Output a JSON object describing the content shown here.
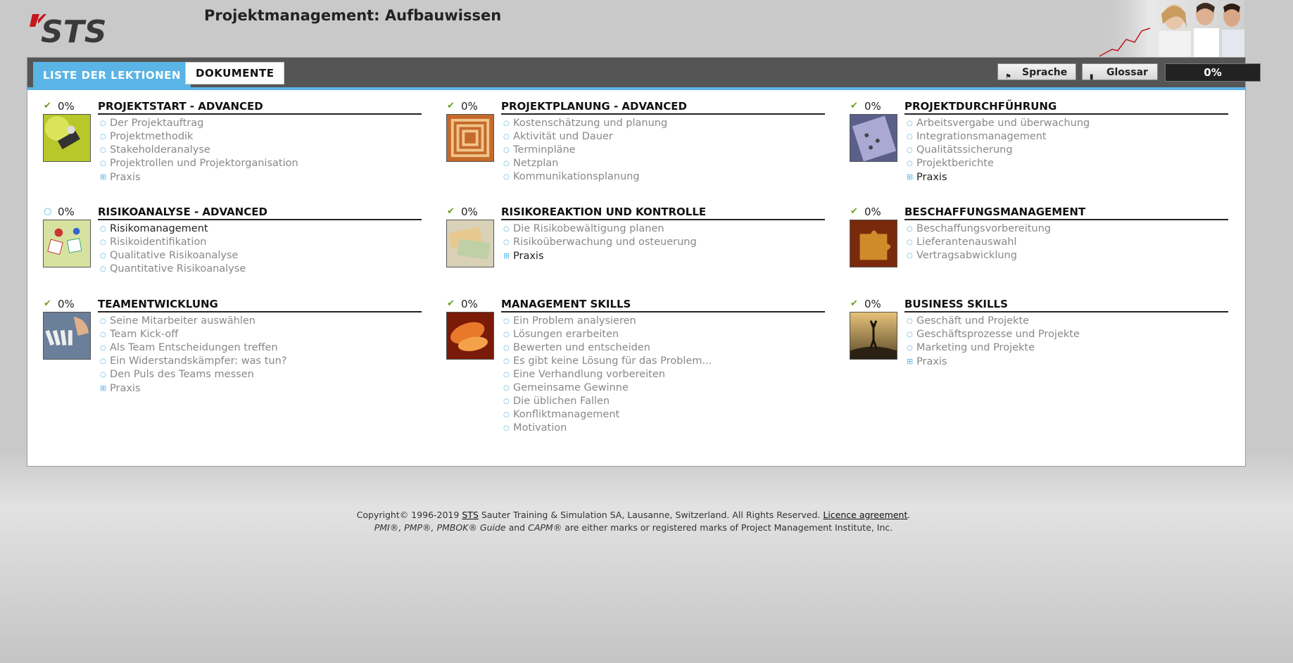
{
  "header": {
    "title": "Projektmanagement: Aufbauwissen"
  },
  "tabs": {
    "active": "LISTE DER LEKTIONEN",
    "inactive": "DOKUMENTE"
  },
  "toolbar": {
    "language_label": "Sprache",
    "glossary_label": "Glossar",
    "overall_progress": "0%"
  },
  "modules": [
    {
      "title": "PROJEKTSTART - ADVANCED",
      "progress": "0%",
      "status": "check",
      "lessons": [
        "Der Projektauftrag",
        "Projektmethodik",
        "Stakeholderanalyse",
        "Projektrollen und Projektorganisation"
      ],
      "practice": "Praxis"
    },
    {
      "title": "PROJEKTPLANUNG - ADVANCED",
      "progress": "0%",
      "status": "check",
      "lessons": [
        "Kostenschätzung und planung",
        "Aktivität und Dauer",
        "Terminpläne",
        "Netzplan",
        "Kommunikationsplanung"
      ]
    },
    {
      "title": "PROJEKTDURCHFÜHRUNG",
      "progress": "0%",
      "status": "check",
      "lessons": [
        "Arbeitsvergabe und überwachung",
        "Integrationsmanagement",
        "Qualitätssicherung",
        "Projektberichte"
      ],
      "practice": "Praxis"
    },
    {
      "title": "RISIKOANALYSE - ADVANCED",
      "progress": "0%",
      "status": "circle",
      "lessons": [
        "Risikomanagement",
        "Risikoidentifikation",
        "Qualitative Risikoanalyse",
        "Quantitative Risikoanalyse"
      ]
    },
    {
      "title": "RISIKOREAKTION UND KONTROLLE",
      "progress": "0%",
      "status": "check",
      "lessons": [
        "Die Risikobewältigung planen",
        "Risikoüberwachung und osteuerung"
      ],
      "practice": "Praxis"
    },
    {
      "title": "BESCHAFFUNGSMANAGEMENT",
      "progress": "0%",
      "status": "check",
      "lessons": [
        "Beschaffungsvorbereitung",
        "Lieferantenauswahl",
        "Vertragsabwicklung"
      ]
    },
    {
      "title": "TEAMENTWICKLUNG",
      "progress": "0%",
      "status": "check",
      "lessons": [
        "Seine Mitarbeiter auswählen",
        "Team Kick-off",
        "Als Team Entscheidungen treffen",
        "Ein Widerstandskämpfer: was tun?",
        "Den Puls des Teams messen"
      ],
      "practice": "Praxis"
    },
    {
      "title": "MANAGEMENT SKILLS",
      "progress": "0%",
      "status": "check",
      "lessons": [
        "Ein Problem analysieren",
        "Lösungen erarbeiten",
        "Bewerten und entscheiden",
        "Es gibt keine Lösung für das Problem...",
        "Eine Verhandlung vorbereiten",
        "Gemeinsame Gewinne",
        "Die üblichen Fallen",
        "Konfliktmanagement",
        "Motivation"
      ]
    },
    {
      "title": "BUSINESS SKILLS",
      "progress": "0%",
      "status": "check",
      "lessons": [
        "Geschäft und Projekte",
        "Geschäftsprozesse und Projekte",
        "Marketing und Projekte"
      ],
      "practice": "Praxis"
    }
  ],
  "footer": {
    "copyright_prefix": "Copyright© 1996-2019",
    "company_link": "STS",
    "copyright_text": "Sauter Training & Simulation SA, Lausanne, Switzerland. All Rights Reserved.",
    "licence_link": "Licence agreement",
    "marks_italic_1": "PMI®, PMP®, PMBOK® Guide",
    "marks_and": "and",
    "marks_italic_2": "CAPM®",
    "marks_text": "are either marks or registered marks of Project Management Institute, Inc."
  },
  "colors": {
    "accent": "#5ab4e5",
    "tabbar": "#555555",
    "check": "#6a9e1f",
    "logo_red": "#c4161c",
    "logo_dark": "#3a3a3a"
  }
}
